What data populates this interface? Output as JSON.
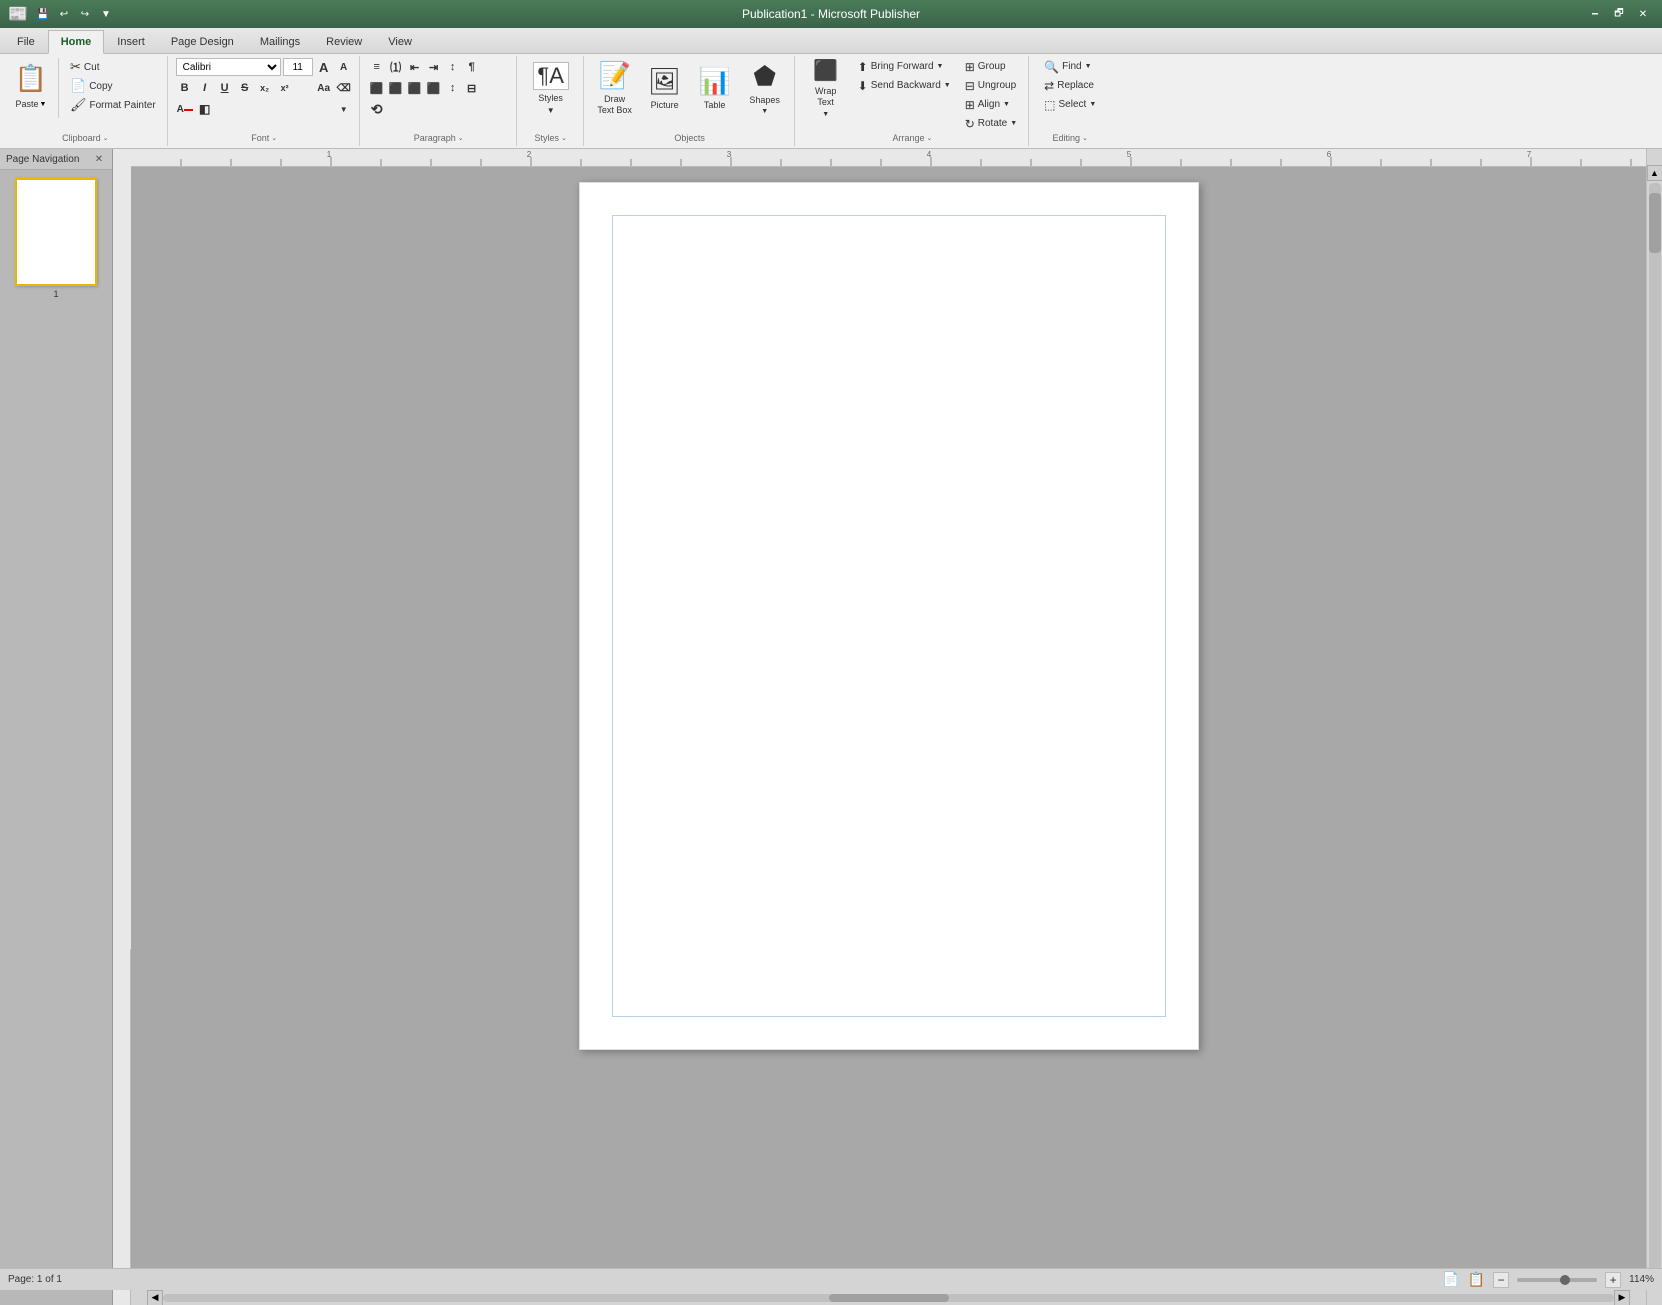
{
  "window": {
    "title": "Publication1 - Microsoft Publisher",
    "minimize_btn": "🗕",
    "restore_btn": "🗗",
    "close_btn": "✕"
  },
  "quick_access": {
    "save": "💾",
    "undo": "↩",
    "redo": "↪",
    "dropdown": "▼"
  },
  "tabs": [
    {
      "id": "file",
      "label": "File"
    },
    {
      "id": "home",
      "label": "Home",
      "active": true
    },
    {
      "id": "insert",
      "label": "Insert"
    },
    {
      "id": "page-design",
      "label": "Page Design"
    },
    {
      "id": "mailings",
      "label": "Mailings"
    },
    {
      "id": "review",
      "label": "Review"
    },
    {
      "id": "view",
      "label": "View"
    }
  ],
  "ribbon": {
    "clipboard": {
      "label": "Clipboard",
      "paste_label": "Paste",
      "cut_label": "Cut",
      "copy_label": "Copy",
      "format_painter_label": "Format Painter"
    },
    "font": {
      "label": "Font",
      "font_name": "Calibri",
      "font_size": "11",
      "bold": "B",
      "italic": "I",
      "underline": "U",
      "strikethrough": "S",
      "subscript": "x₂",
      "superscript": "x²",
      "font_color": "A",
      "highlight": "◧",
      "grow": "A↑",
      "shrink": "A↓",
      "case": "Aa",
      "clear": "⌫",
      "increase_size": "A",
      "decrease_size": "A"
    },
    "paragraph": {
      "label": "Paragraph",
      "bullets": "≡",
      "numbering": "1.",
      "decrease_indent": "⇤",
      "increase_indent": "⇥",
      "sort": "↕",
      "show_marks": "¶",
      "align_left": "≡",
      "align_center": "≡",
      "align_right": "≡",
      "justify": "≡",
      "line_spacing": "↕",
      "columns": "⊟",
      "text_direction": "⟲"
    },
    "styles": {
      "label": "Styles",
      "styles_label": "Styles",
      "styles_icon": "¶A"
    },
    "objects": {
      "label": "Objects",
      "draw_text_box_label": "Draw\nText Box",
      "picture_label": "Picture",
      "table_label": "Table",
      "shapes_label": "Shapes"
    },
    "arrange": {
      "label": "Arrange",
      "wrap_text_label": "Wrap\nText",
      "bring_forward_label": "Bring Forward",
      "send_backward_label": "Send Backward",
      "group_label": "Group",
      "ungroup_label": "Ungroup",
      "align_label": "Align",
      "rotate_label": "Rotate"
    },
    "editing": {
      "label": "Editing",
      "find_label": "Find",
      "replace_label": "Replace",
      "select_label": "Select"
    }
  },
  "page_navigation": {
    "label": "Page Navigation",
    "pages": [
      {
        "num": 1
      }
    ]
  },
  "status_bar": {
    "page_info": "Page: 1 of 1",
    "zoom_level": "114%",
    "view_icons": [
      "📄",
      "📋"
    ]
  }
}
